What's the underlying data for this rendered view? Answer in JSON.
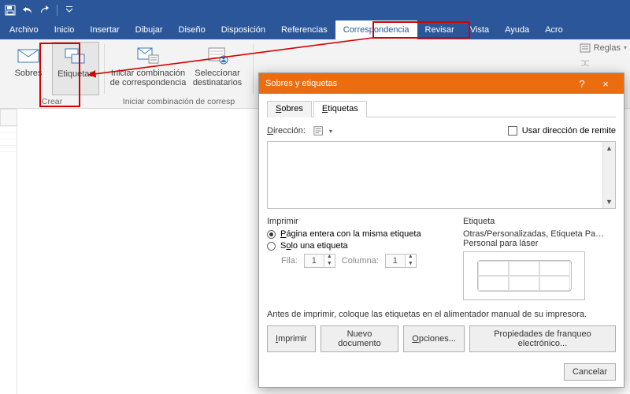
{
  "qat": {
    "icons": [
      "save-icon",
      "undo-icon",
      "redo-icon",
      "dropdown-icon"
    ]
  },
  "tabs": {
    "items": [
      "Archivo",
      "Inicio",
      "Insertar",
      "Dibujar",
      "Diseño",
      "Disposición",
      "Referencias",
      "Correspondencia",
      "Revisar",
      "Vista",
      "Ayuda",
      "Acro"
    ],
    "active": "Correspondencia"
  },
  "ribbon": {
    "group_create": {
      "title": "Crear",
      "sobres": "Sobres",
      "etiquetas": "Etiquetas"
    },
    "group_start": {
      "title": "Iniciar combinación de corresp",
      "iniciar": "Iniciar combinación\nde correspondencia",
      "seleccionar": "Seleccionar\ndestinatarios"
    },
    "rules": "Reglas"
  },
  "dialog": {
    "title": "Sobres y etiquetas",
    "help": "?",
    "close": "×",
    "tabs": {
      "sobres": "Sobres",
      "etiquetas": "Etiquetas",
      "active": "etiquetas"
    },
    "direccion_label": "Dirección:",
    "usar_remite": "Usar dirección de remite",
    "imprimir": {
      "title": "Imprimir",
      "full_page": "Página entera con la misma etiqueta",
      "single": "Solo una etiqueta",
      "fila_label": "Fila:",
      "fila_value": "1",
      "col_label": "Columna:",
      "col_value": "1",
      "selected": "full"
    },
    "etiqueta": {
      "title": "Etiqueta",
      "line1": "Otras/Personalizadas, Etiqueta Pa…",
      "line2": "Personal para láser"
    },
    "note": "Antes de imprimir, coloque las etiquetas en el alimentador manual de su impresora.",
    "buttons": {
      "imprimir": "Imprimir",
      "nuevo": "Nuevo documento",
      "opciones": "Opciones...",
      "props": "Propiedades de franqueo electrónico...",
      "cancelar": "Cancelar"
    }
  }
}
